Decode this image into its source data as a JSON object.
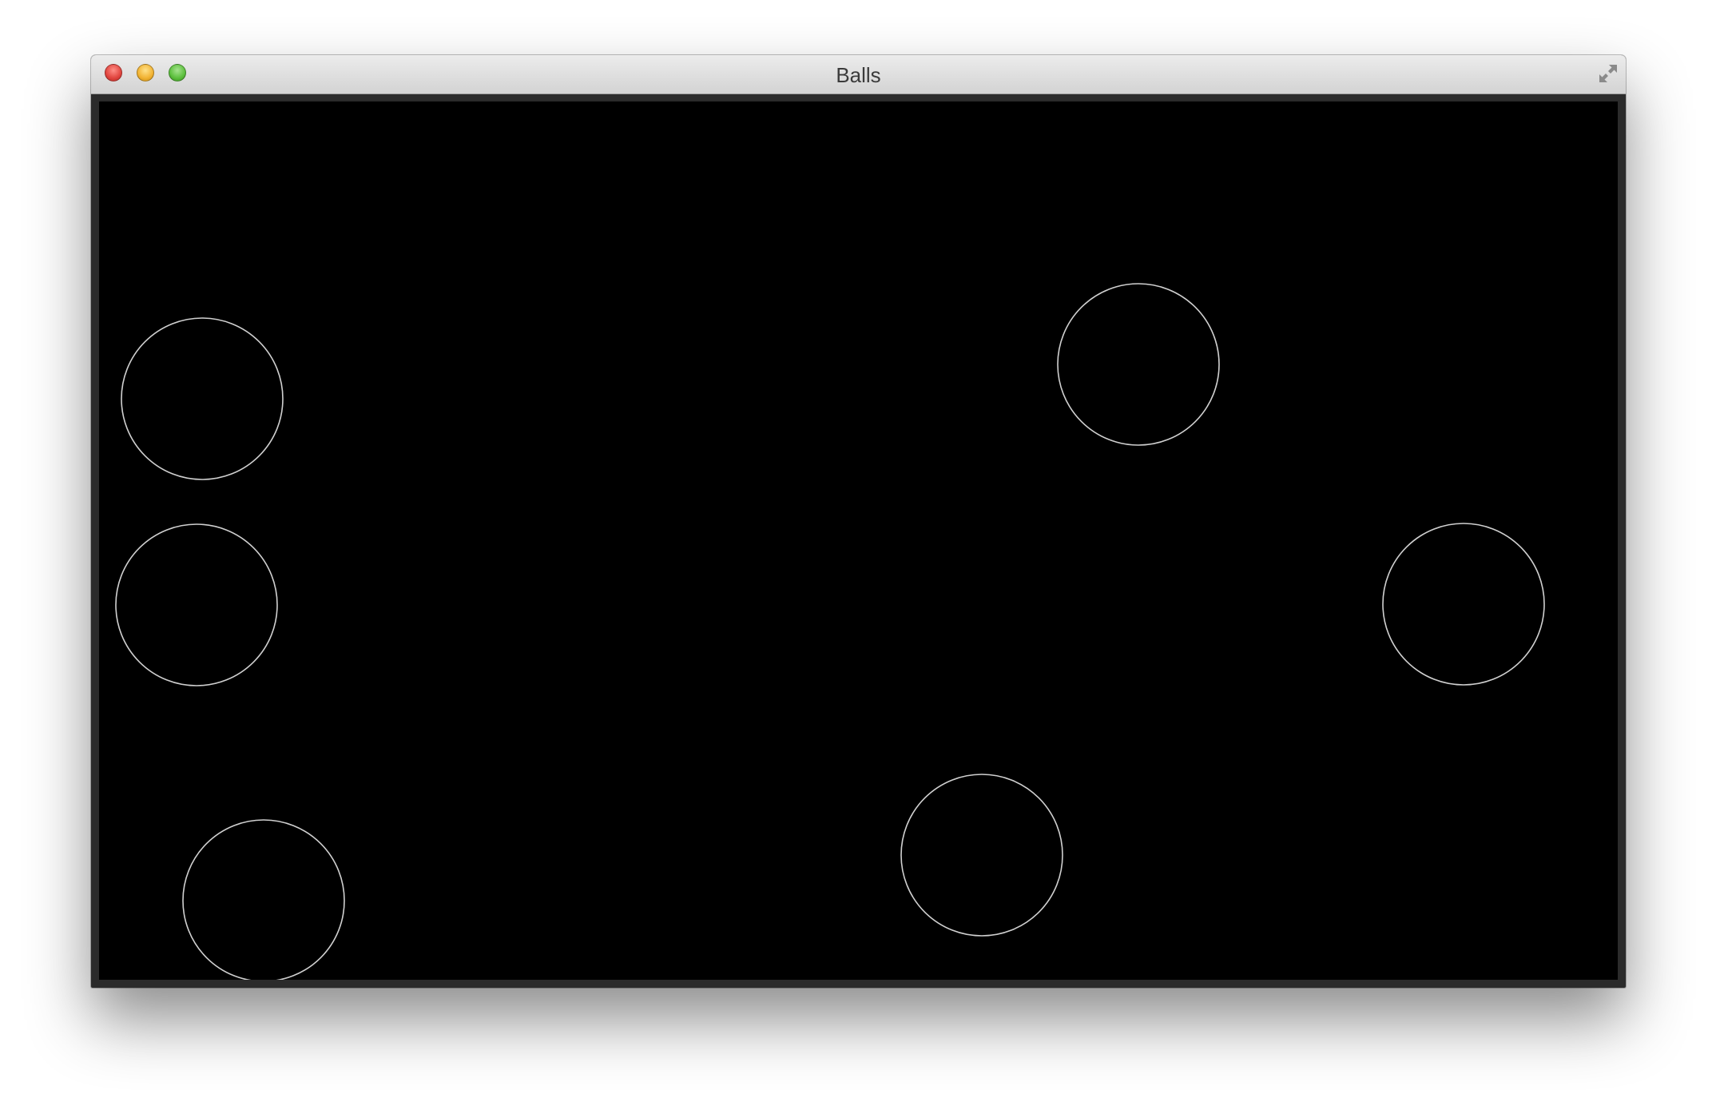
{
  "window": {
    "title": "Balls",
    "background_color": "#000000",
    "ball_stroke_color": "#d0d0d0"
  },
  "balls": [
    {
      "name": "ball-1"
    },
    {
      "name": "ball-2"
    },
    {
      "name": "ball-3"
    },
    {
      "name": "ball-4"
    },
    {
      "name": "ball-5"
    },
    {
      "name": "ball-6"
    }
  ],
  "icons": {
    "close": "close-button",
    "minimize": "minimize-button",
    "zoom": "zoom-button",
    "fullscreen": "fullscreen-icon"
  }
}
